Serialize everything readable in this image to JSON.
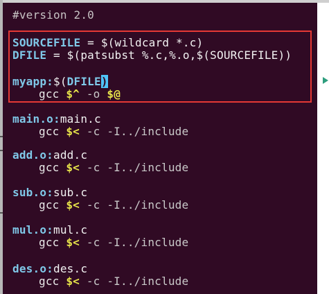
{
  "editor": {
    "version_line": "#version 2.0",
    "sourcefile": {
      "name": "SOURCEFILE",
      "op": " = ",
      "value": "$(wildcard *.c)"
    },
    "dfile": {
      "name": "DFILE",
      "op": " = ",
      "value": "$(patsubst %.c,%.o,$(SOURCEFILE))"
    },
    "myapp": {
      "target": "myapp:",
      "dep_prefix": "$(",
      "dep_var": "DFILE",
      "dep_suffix": ")",
      "cmd": "gcc ",
      "auto1": "$^",
      "flag": " -o ",
      "auto2": "$@"
    },
    "rules": [
      {
        "target": "main.o:",
        "dep": "main.c",
        "cmd": "gcc ",
        "auto": "$<",
        "flags": " -c -I../include"
      },
      {
        "target": "add.o:",
        "dep": "add.c",
        "cmd": "gcc ",
        "auto": "$<",
        "flags": " -c -I../include"
      },
      {
        "target": "sub.o:",
        "dep": "sub.c",
        "cmd": "gcc ",
        "auto": "$<",
        "flags": " -c -I../include"
      },
      {
        "target": "mul.o:",
        "dep": "mul.c",
        "cmd": "gcc ",
        "auto": "$<",
        "flags": " -c -I../include"
      },
      {
        "target": "des.o:",
        "dep": "des.c",
        "cmd": "gcc ",
        "auto": "$<",
        "flags": " -c -I../include"
      }
    ]
  },
  "colors": {
    "background": "#300a24",
    "highlight_box": "#e53935",
    "variable": "#7fc8e8",
    "automatic_var": "#e6e34a"
  }
}
